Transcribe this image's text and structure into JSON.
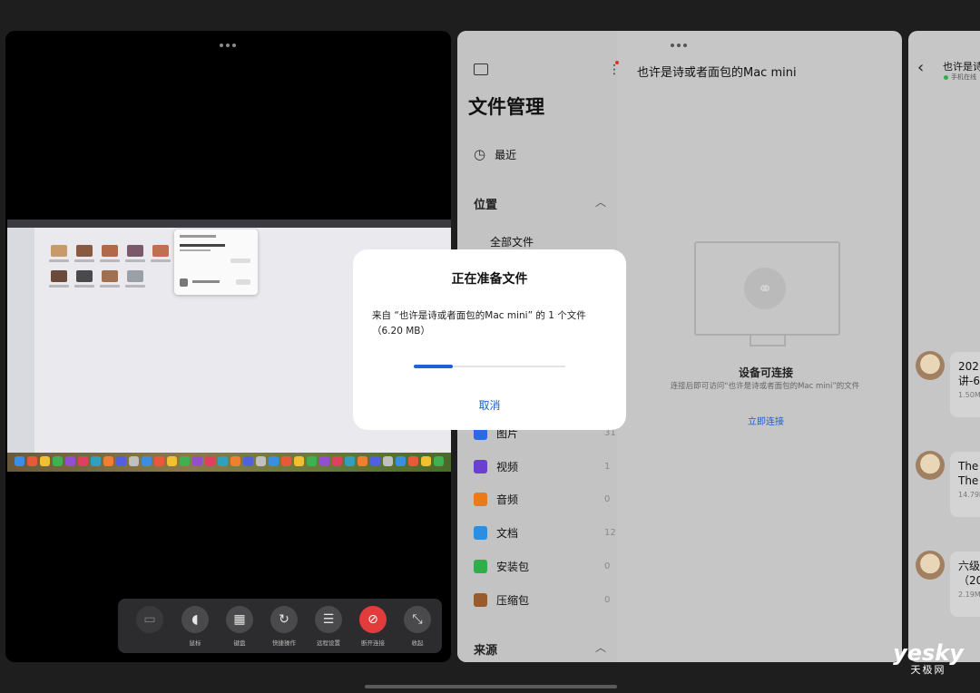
{
  "remote": {
    "toolbar": [
      {
        "label": "",
        "icon": "screen-icon"
      },
      {
        "label": "鼠标",
        "icon": "mouse-icon"
      },
      {
        "label": "键盘",
        "icon": "keyboard-icon"
      },
      {
        "label": "快捷操作",
        "icon": "refresh-icon"
      },
      {
        "label": "远程设置",
        "icon": "sliders-icon"
      },
      {
        "label": "断开连接",
        "icon": "unlink-icon"
      },
      {
        "label": "收起",
        "icon": "collapse-icon"
      }
    ]
  },
  "file_manager": {
    "title": "文件管理",
    "recent": "最近",
    "location_header": "位置",
    "all_files": "全部文件",
    "categories": [
      {
        "label": "图片",
        "count": "31",
        "color": "#2d6ae0"
      },
      {
        "label": "视频",
        "count": "1",
        "color": "#6b3fd0"
      },
      {
        "label": "音频",
        "count": "0",
        "color": "#ea7a1a"
      },
      {
        "label": "文档",
        "count": "12",
        "color": "#2d8ee0"
      },
      {
        "label": "安装包",
        "count": "0",
        "color": "#2fae4a"
      },
      {
        "label": "压缩包",
        "count": "0",
        "color": "#9a5a2a"
      }
    ],
    "source_header": "来源",
    "device_title": "也许是诗或者面包的Mac mini",
    "device_status": "设备可连接",
    "device_desc": "连接后即可访问“也许是诗或者面包的Mac mini”的文件",
    "connect_now": "立即连接"
  },
  "chat": {
    "title": "也许是诗",
    "subtitle": "手机在线",
    "messages": [
      {
        "text": "202",
        "text2": "讲-6",
        "size": "1.50M"
      },
      {
        "text": "The",
        "text2": "The",
        "size": "14.79M"
      },
      {
        "text": "六级",
        "text2": "（20",
        "size": "2.19M"
      }
    ]
  },
  "dialog": {
    "title": "正在准备文件",
    "message": "来自 “也许是诗或者面包的Mac mini” 的 1 个文件（6.20 MB）",
    "progress": 0.26,
    "cancel": "取消"
  },
  "watermark": {
    "top": "yesky",
    "bottom": "天极网"
  }
}
